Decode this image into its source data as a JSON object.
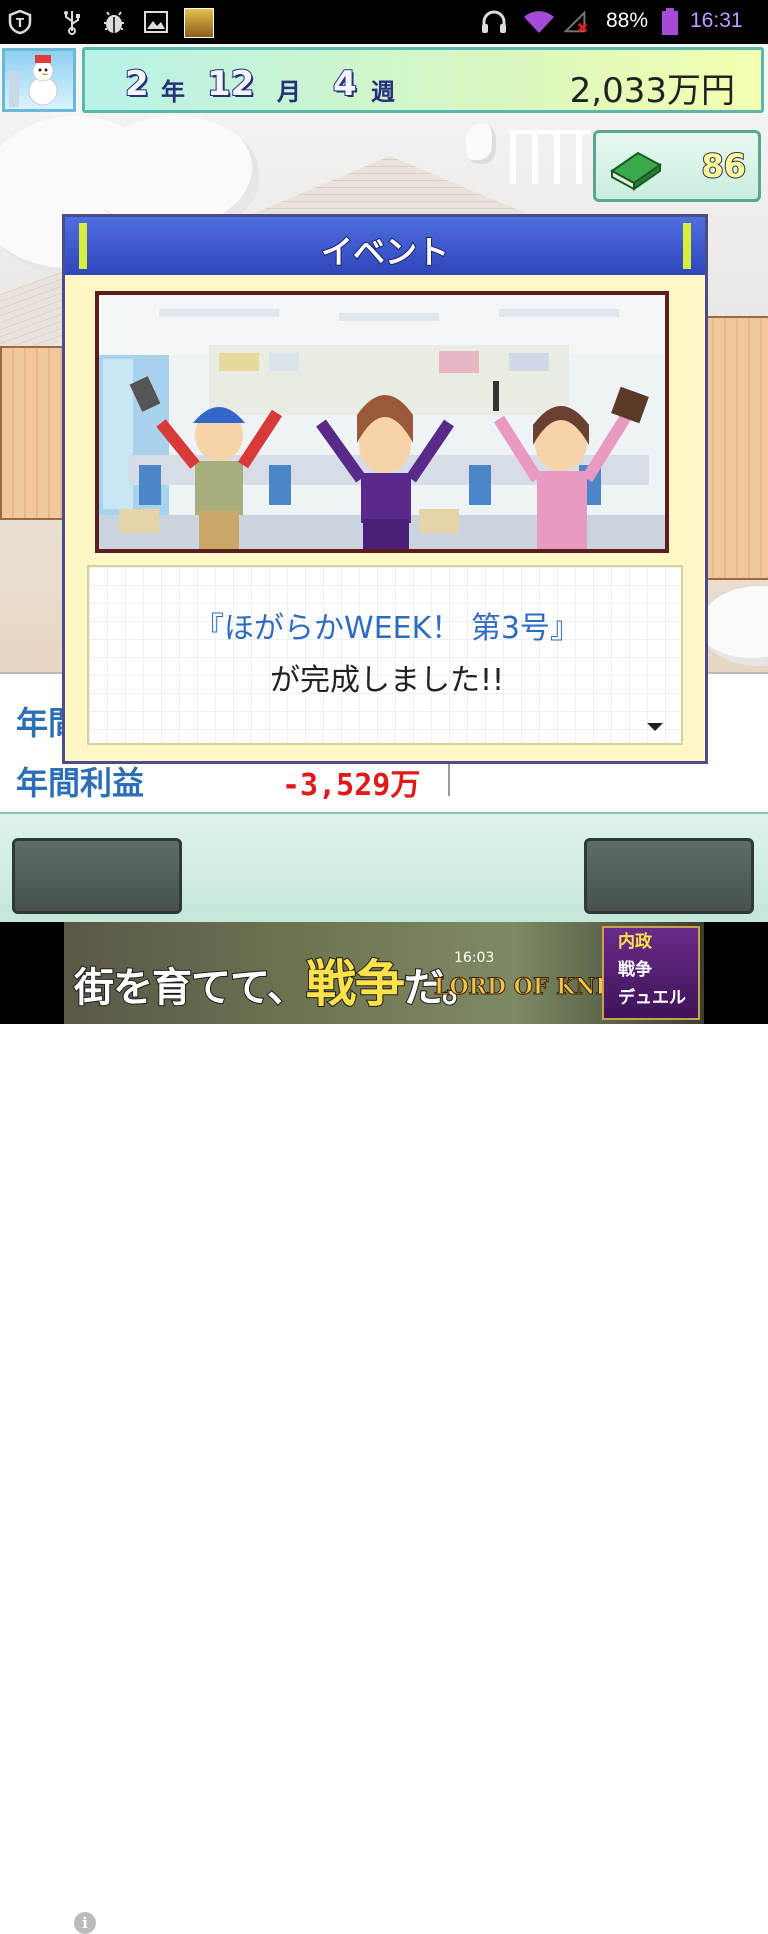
{
  "status_bar": {
    "battery_percent": "88%",
    "time": "16:31",
    "icons": [
      "shield-app-icon",
      "usb-icon",
      "debug-bug-icon",
      "picture-icon",
      "game-app-icon",
      "headphones-icon",
      "wifi-icon",
      "no-signal-icon",
      "battery-icon"
    ]
  },
  "game_header": {
    "year_num": "2",
    "year_unit": "年",
    "month_num": "12",
    "month_unit": "月",
    "week_num": "4",
    "week_unit": "週",
    "money": "2,033万円"
  },
  "resources": {
    "books_count": "86",
    "books_icon": "green-book-icon"
  },
  "dialog": {
    "title": "イベント",
    "message_line1": "『ほがらかWEEK！ 第3号』",
    "message_line2": "が完成しました!!"
  },
  "stats": {
    "label_1": "年間",
    "label_2": "年間利益",
    "value_2": "-3,529万",
    "trailing_mark": ","
  },
  "ad": {
    "headline_part1": "街を育てて、",
    "headline_big": "戦争",
    "headline_part2": "だ。",
    "logo": "LORD OF KNIGHTS",
    "clock": "16:03",
    "menu": [
      "内政",
      "戦争",
      "デュエル"
    ]
  },
  "colors": {
    "dialog_header": "#2e45b8",
    "stat_label": "#2d6fb5",
    "negative_value": "#e01919",
    "message_highlight": "#2f6cbf"
  }
}
